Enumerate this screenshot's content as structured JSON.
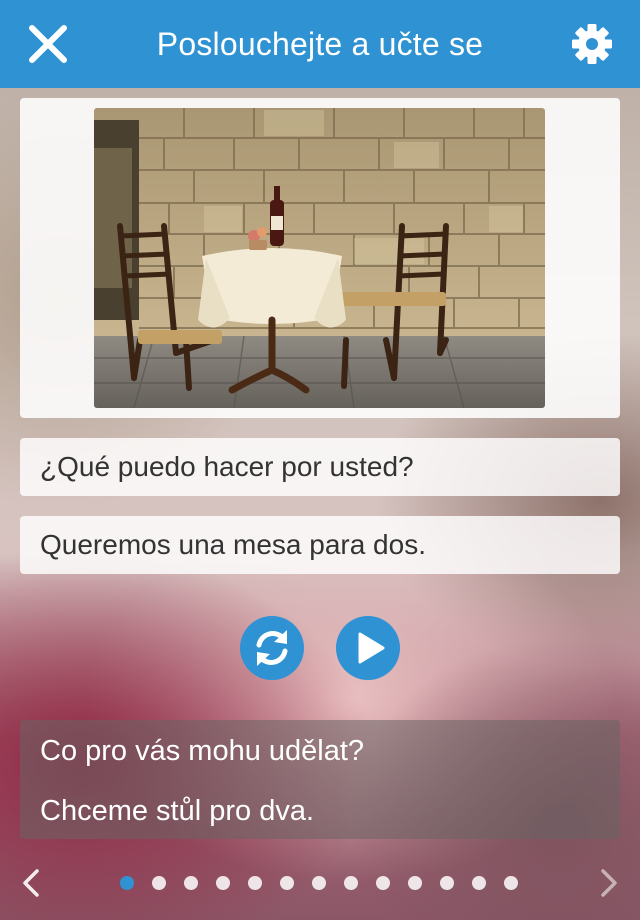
{
  "header": {
    "title": "Poslouchejte a učte se",
    "close_icon": "close-icon",
    "settings_icon": "gear-icon",
    "color": "#2f92d3"
  },
  "image": {
    "icon": "cafe-table-photo"
  },
  "phrases": [
    {
      "text": "¿Qué puedo hacer por usted?"
    },
    {
      "text": "Queremos una mesa para dos."
    }
  ],
  "controls": {
    "repeat_icon": "repeat-icon",
    "play_icon": "play-icon"
  },
  "translation": {
    "lines": [
      "Co pro vás mohu udělat?",
      "Chceme stůl pro dva."
    ]
  },
  "pager": {
    "total": 13,
    "current": 1,
    "prev_icon": "chevron-left-icon",
    "next_icon": "chevron-right-icon"
  }
}
